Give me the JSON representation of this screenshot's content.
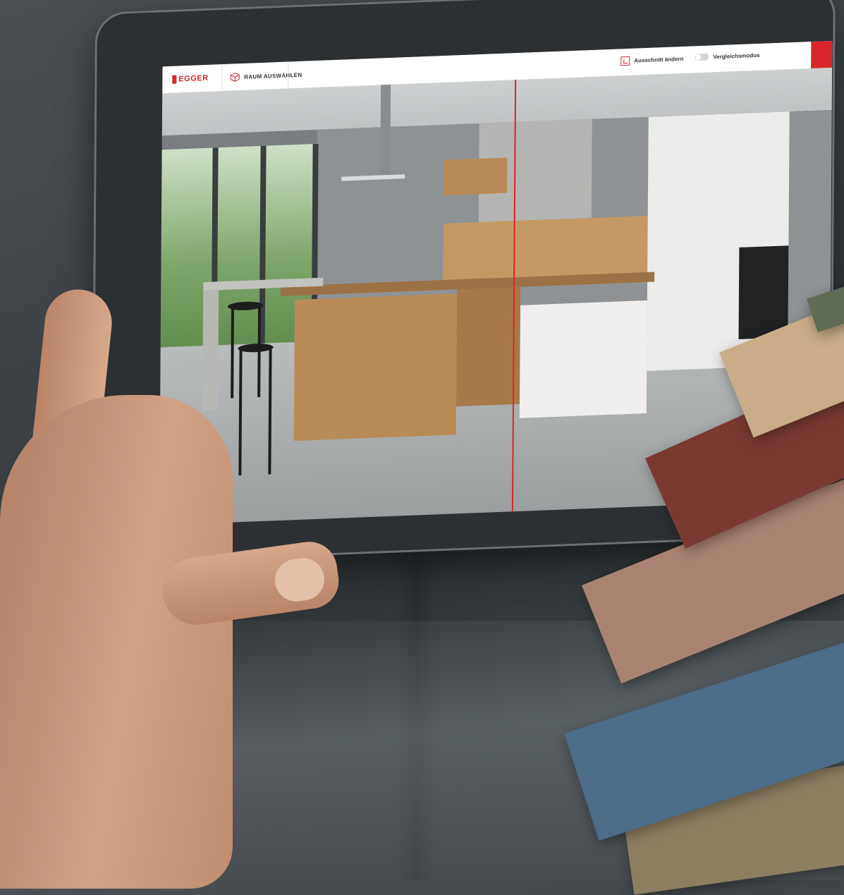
{
  "app": {
    "brand": "EGGER",
    "room_select_label": "RAUM AUSWÄHLEN",
    "change_crop_label": "Ausschnitt ändern",
    "compare_mode_label": "Vergleichsmodus",
    "compare_mode_on": false,
    "accent_color": "#d8262b"
  },
  "icons": {
    "room_select": "cube-icon",
    "change_crop": "crop-icon",
    "compare_toggle": "toggle-switch"
  },
  "swatches": [
    {
      "color": "#5f6b52"
    },
    {
      "color": "#c8ad88"
    },
    {
      "color": "#7a3a32"
    },
    {
      "color": "#a98372"
    },
    {
      "color": "#4c6c88"
    },
    {
      "color": "#8d7e62"
    }
  ]
}
